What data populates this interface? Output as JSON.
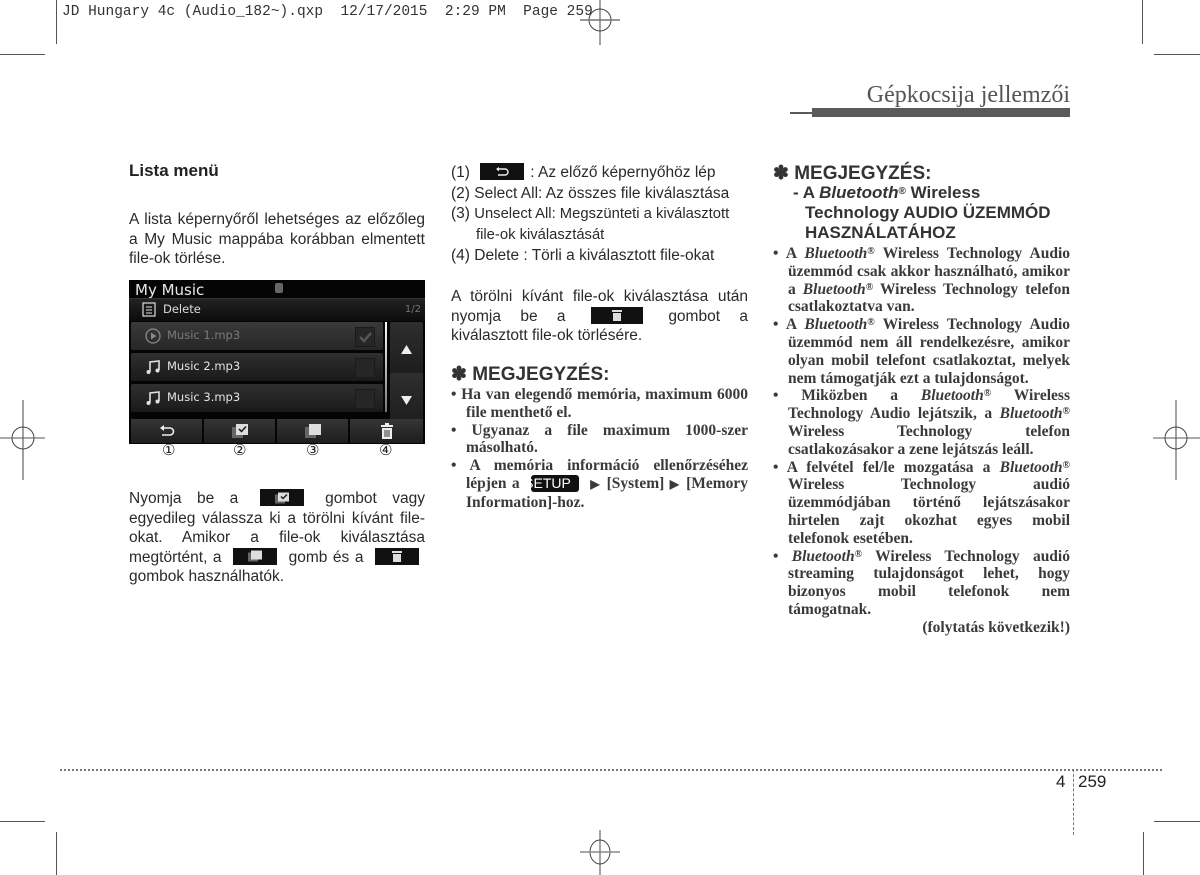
{
  "slug": "JD Hungary 4c (Audio_182~).qxp  12/17/2015  2:29 PM  Page 259",
  "header": {
    "title": "Gépkocsija jellemzői"
  },
  "left_column": {
    "heading": "Lista menü",
    "intro": "A lista képernyőről lehetséges az előzőleg a My Music mappába korábban elmentett file-ok törlése.",
    "screen": {
      "title": "My Music",
      "subtitle": "Delete",
      "page": "1/2",
      "rows": [
        {
          "label": "Music 1.mp3",
          "icon": "play-circle-icon",
          "checked": true
        },
        {
          "label": "Music 2.mp3",
          "icon": "music-note-icon",
          "checked": false
        },
        {
          "label": "Music 3.mp3",
          "icon": "music-note-icon",
          "checked": false
        }
      ],
      "toolbar": [
        "back-icon",
        "select-all-icon",
        "unselect-all-icon",
        "trash-icon"
      ],
      "callouts": [
        "①",
        "②",
        "③",
        "④"
      ]
    },
    "para2": {
      "part1": "Nyomja be a",
      "part2": "gombot vagy egyedileg válassza ki a törölni kívánt file-okat. Amikor a file-ok kiválasztása megtörtént, a",
      "part3": "gomb és a",
      "part4": "gombok használhatók."
    }
  },
  "middle_column": {
    "items": [
      {
        "num": "(1)",
        "text": ": Az előző képernyőhöz lép"
      },
      {
        "num": "(2)",
        "text": "Select All: Az összes file kiválasztása"
      },
      {
        "num": "(3)",
        "text": "Unselect All: Megszünteti a kiválasztott file-ok kiválasztását"
      },
      {
        "num": "(4)",
        "text": "Delete : Törli a kiválasztott file-okat"
      }
    ],
    "para": {
      "part1": "A törölni kívánt file-ok kiválasztása után nyomja be a",
      "part2": "gombot a kiválasztott file-ok törlésére."
    },
    "note": {
      "heading": "✽ MEGJEGYZÉS:",
      "bullets": [
        "Ha van elegendő memória, maximum 6000 file menthető el.",
        "Ugyanaz a file maximum 1000-szer másolható."
      ],
      "bullet3": {
        "part1": "A memória információ ellenőrzéséhez lépjen a",
        "setup": "SETUP",
        "arrow": "▶",
        "system": "[System]",
        "part2": "[Memory Information]-hoz."
      }
    }
  },
  "right_column": {
    "heading": "✽ MEGJEGYZÉS:",
    "sub": {
      "dash": "- A",
      "bt": "Bluetooth",
      "reg": "®",
      "rest1": "Wireless",
      "rest2": "Technology AUDIO ÜZEMMÓD HASZNÁLATÁHOZ"
    },
    "bullets": [
      "A <i>Bluetooth</i><sup>®</sup> Wireless Technology Audio üzemmód csak akkor használható, amikor a <i>Bluetooth</i><sup>®</sup> Wireless Technology telefon csatlakoztatva van.",
      "A <i>Bluetooth</i><sup>®</sup> Wireless Technology Audio üzemmód nem áll rendelkezésre, amikor olyan mobil telefont csatlakoztat, melyek nem támogatják ezt a tulajdonságot.",
      "Miközben a <i>Bluetooth</i><sup>®</sup> Wireless Technology Audio lejátszik, a <i>Bluetooth</i><sup>®</sup> Wireless Technology telefon csatlakozásakor a zene lejátszás leáll.",
      "A felvétel fel/le mozgatása a <i>Bluetooth</i><sup>®</sup> Wireless Technology audió üzemmódjában történő lejátszásakor hirtelen zajt okozhat egyes mobil telefonok esetében.",
      "<i>Bluetooth</i><sup>®</sup> Wireless Technology audió streaming tulajdonságot lehet, hogy bizonyos mobil telefonok nem támogatnak."
    ],
    "continued": "(folytatás következik!)"
  },
  "footer": {
    "chapter": "4",
    "page": "259"
  }
}
